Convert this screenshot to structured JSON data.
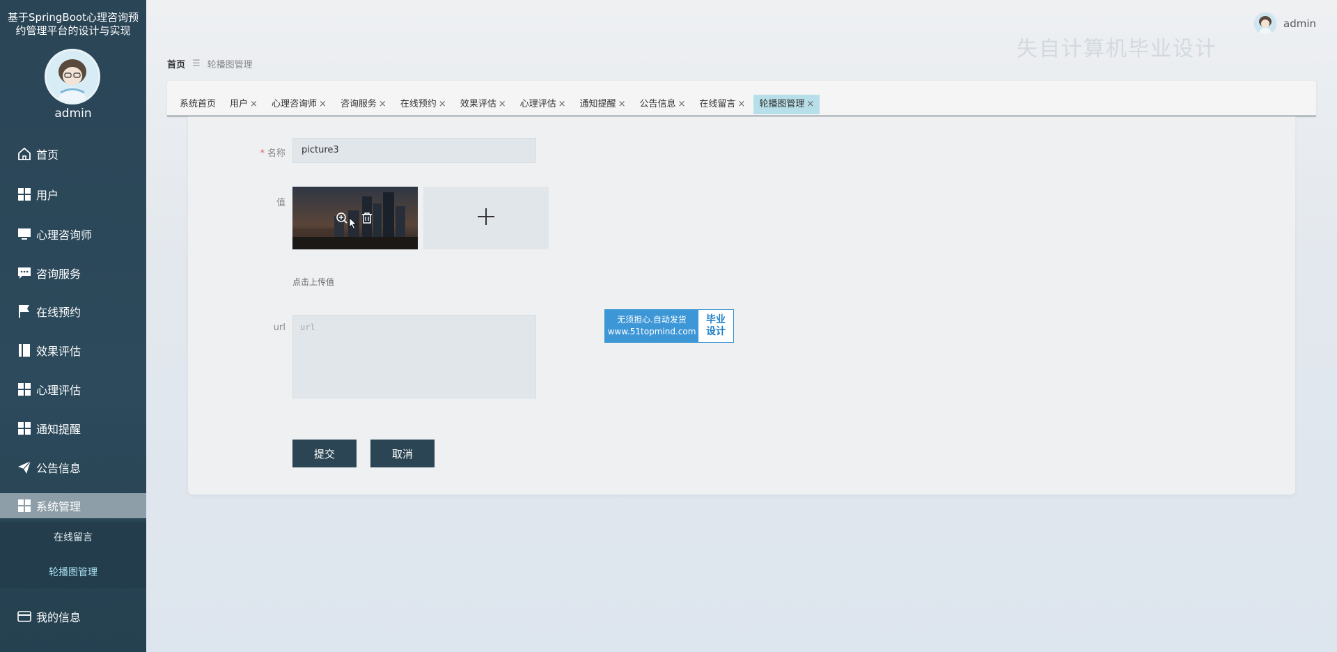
{
  "app": {
    "title": "基于SpringBoot心理咨询预约管理平台的设计与实现"
  },
  "sidebar": {
    "user_name": "admin",
    "items": [
      {
        "label": "首页",
        "icon": "home-icon"
      },
      {
        "label": "用户",
        "icon": "grid-icon"
      },
      {
        "label": "心理咨询师",
        "icon": "monitor-icon"
      },
      {
        "label": "咨询服务",
        "icon": "chat-icon"
      },
      {
        "label": "在线预约",
        "icon": "flag-icon"
      },
      {
        "label": "效果评估",
        "icon": "book-icon"
      },
      {
        "label": "心理评估",
        "icon": "grid-icon"
      },
      {
        "label": "通知提醒",
        "icon": "grid-icon"
      },
      {
        "label": "公告信息",
        "icon": "send-icon"
      },
      {
        "label": "系统管理",
        "icon": "grid-icon"
      },
      {
        "label": "我的信息",
        "icon": "card-icon"
      }
    ],
    "submenu": [
      {
        "label": "在线留言"
      },
      {
        "label": "轮播图管理"
      }
    ]
  },
  "header": {
    "user_name": "admin",
    "watermark": "失自计算机毕业设计"
  },
  "breadcrumb": {
    "home": "首页",
    "current": "轮播图管理"
  },
  "tabs": [
    {
      "label": "系统首页",
      "closable": false
    },
    {
      "label": "用户",
      "closable": true
    },
    {
      "label": "心理咨询师",
      "closable": true
    },
    {
      "label": "咨询服务",
      "closable": true
    },
    {
      "label": "在线预约",
      "closable": true
    },
    {
      "label": "效果评估",
      "closable": true
    },
    {
      "label": "心理评估",
      "closable": true
    },
    {
      "label": "通知提醒",
      "closable": true
    },
    {
      "label": "公告信息",
      "closable": true
    },
    {
      "label": "在线留言",
      "closable": true
    },
    {
      "label": "轮播图管理",
      "closable": true,
      "active": true
    }
  ],
  "close_glyph": "×",
  "form": {
    "name_label": "名称",
    "name_required": "*",
    "name_value": "picture3",
    "value_label": "值",
    "upload_hint": "点击上传值",
    "url_label": "url",
    "url_placeholder": "url",
    "submit_label": "提交",
    "cancel_label": "取消"
  },
  "ad": {
    "line1": "无须担心.自动发货",
    "line2": "www.51topmind.com",
    "right1": "毕业",
    "right2": "设计"
  }
}
